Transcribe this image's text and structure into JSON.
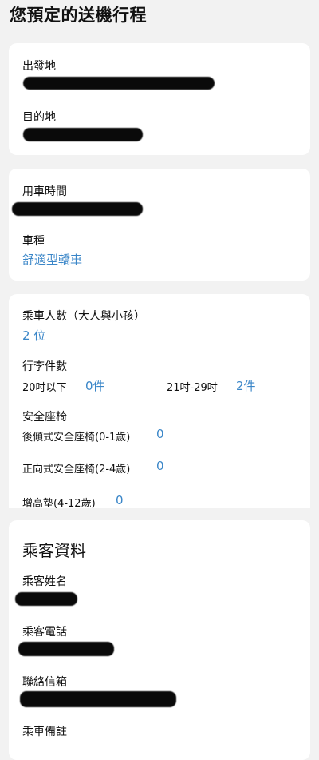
{
  "page": {
    "title": "您預定的送機行程"
  },
  "route": {
    "origin_label": "出發地",
    "destination_label": "目的地"
  },
  "vehicle": {
    "time_label": "用車時間",
    "type_label": "車種",
    "type_value": "舒適型轎車"
  },
  "passengers": {
    "count_label": "乘車人數（大人與小孩）",
    "count_value": "2 位",
    "luggage_label": "行李件數",
    "luggage_small_label": "20吋以下",
    "luggage_small_value": "0件",
    "luggage_large_label": "21吋-29吋",
    "luggage_large_value": "2件",
    "seat_label": "安全座椅",
    "rear_facing_label": "後傾式安全座椅(0-1歲)",
    "rear_facing_value": "0",
    "forward_facing_label": "正向式安全座椅(2-4歲)",
    "forward_facing_value": "0",
    "booster_label": "增高墊(4-12歲)",
    "booster_value": "0"
  },
  "passenger_info": {
    "section_title": "乘客資料",
    "name_label": "乘客姓名",
    "phone_label": "乘客電話",
    "email_label": "聯絡信箱",
    "notes_label": "乘車備註"
  },
  "colors": {
    "accent": "#3a86c8",
    "background": "#f2f2f2",
    "card": "#ffffff"
  }
}
